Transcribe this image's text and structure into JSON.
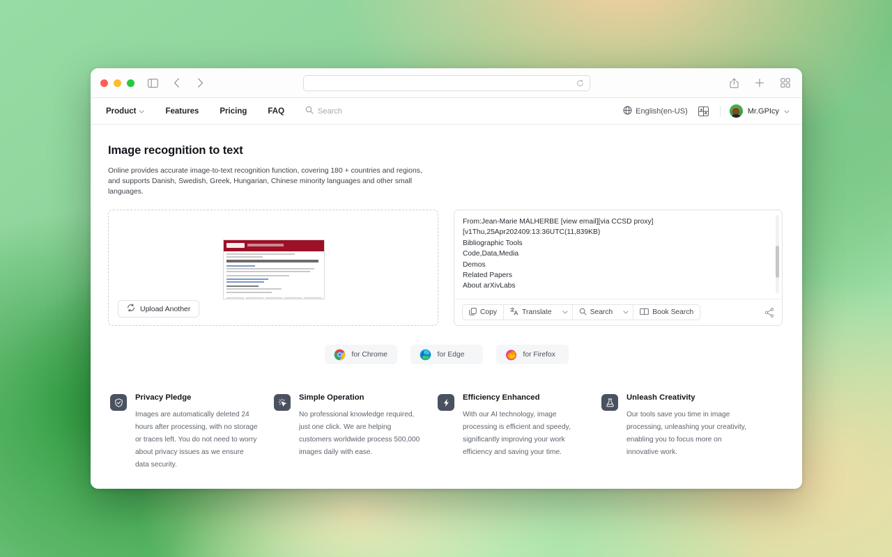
{
  "browser": {
    "url_value": "",
    "url_placeholder": "",
    "reload_icon": "reload-icon",
    "sidebar_icon": "sidebar-toggle-icon",
    "back_icon": "chevron-left-icon",
    "forward_icon": "chevron-right-icon",
    "share_icon": "share-icon",
    "new_tab_icon": "plus-icon",
    "tabs_overview_icon": "tab-overview-icon"
  },
  "nav": {
    "links": [
      {
        "label": "Product",
        "has_caret": true
      },
      {
        "label": "Features",
        "has_caret": false
      },
      {
        "label": "Pricing",
        "has_caret": false
      },
      {
        "label": "FAQ",
        "has_caret": false
      }
    ],
    "search_placeholder": "Search",
    "search_icon": "search-icon",
    "language": "English(en-US)",
    "language_icon": "globe-icon",
    "translate_icon": "translate-grid-icon",
    "user_name": "Mr.GPIcy",
    "user_caret_icon": "chevron-down-icon"
  },
  "main": {
    "title": "Image recognition to text",
    "description": "Online provides accurate image-to-text recognition function, covering 180 + countries and regions, and supports Danish, Swedish, Greek, Hungarian, Chinese minority languages and other small languages."
  },
  "upload": {
    "button_label": "Upload Another",
    "button_icon": "refresh-upload-icon",
    "thumbnail_name": "uploaded-image-thumbnail"
  },
  "result": {
    "lines": [
      "From:Jean-Marie MALHERBE [view email][via CCSD proxy]",
      "[v1Thu,25Apr202409:13:36UTC(11,839KB)",
      "Bibliographic Tools",
      "Code,Data,Media",
      "Demos",
      "Related Papers",
      "About arXivLabs"
    ],
    "toolbar": {
      "copy_label": "Copy",
      "copy_icon": "copy-icon",
      "translate_label": "Translate",
      "translate_icon": "translate-icon",
      "translate_caret_icon": "chevron-down-icon",
      "search_label": "Search",
      "search_icon": "search-icon",
      "search_caret_icon": "chevron-down-icon",
      "book_search_label": "Book Search",
      "book_search_icon": "book-icon",
      "share_icon": "share-nodes-icon"
    }
  },
  "extensions": [
    {
      "label": "for Chrome",
      "icon": "chrome-logo"
    },
    {
      "label": "for Edge",
      "icon": "edge-logo"
    },
    {
      "label": "for Firefox",
      "icon": "firefox-logo"
    }
  ],
  "features": [
    {
      "icon": "shield-check-icon",
      "title": "Privacy Pledge",
      "desc": "Images are automatically deleted 24 hours after processing, with no storage or traces left. You do not need to worry about privacy issues as we ensure data security."
    },
    {
      "icon": "cursor-click-icon",
      "title": "Simple Operation",
      "desc": "No professional knowledge required, just one click. We are helping customers worldwide process 500,000 images daily with ease."
    },
    {
      "icon": "lightning-bolt-icon",
      "title": "Efficiency Enhanced",
      "desc": "With our AI technology, image processing is efficient and speedy, significantly improving your work efficiency and saving your time."
    },
    {
      "icon": "flask-icon",
      "title": "Unleash Creativity",
      "desc": "Our tools save you time in image processing, unleashing your creativity, enabling you to focus more on innovative work."
    }
  ],
  "colors": {
    "accent_dark": "#4a5160",
    "arxiv_red": "#9c1126",
    "traffic_red": "#ff5f57",
    "traffic_yellow": "#febc2e",
    "traffic_green": "#28c840"
  }
}
